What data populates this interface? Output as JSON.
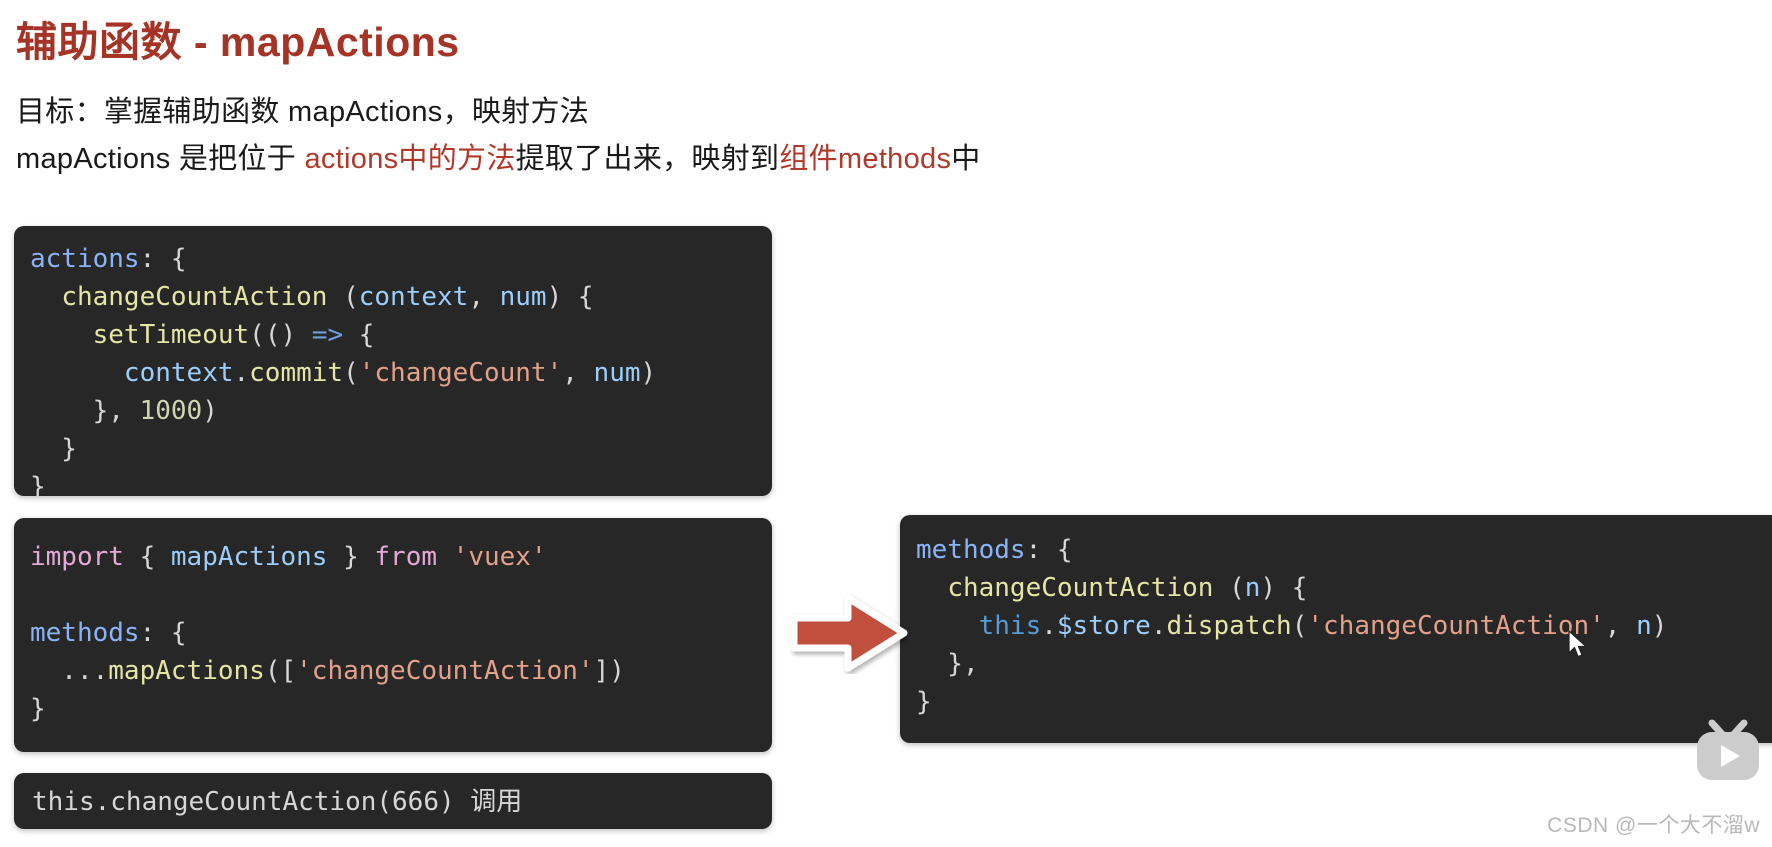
{
  "page": {
    "title": "辅助函数 - mapActions",
    "title_color": "#A53326",
    "background": "#ffffff"
  },
  "prose": {
    "goal": {
      "prefix": "目标：掌握辅助函数 mapActions，映射方法"
    },
    "description": {
      "seg1": "mapActions 是把位于 ",
      "seg2_red": "actions中的方法",
      "seg3": "提取了出来，映射到",
      "seg4_red": "组件methods",
      "seg5": "中"
    }
  },
  "code_blocks": {
    "actions": {
      "name": "actions-store-code",
      "lines": [
        {
          "tokens": [
            {
              "t": "actions",
              "c": "tok-key"
            },
            {
              "t": ": {",
              "c": "tok-plain"
            }
          ]
        },
        {
          "tokens": [
            {
              "t": "  ",
              "c": "tok-plain"
            },
            {
              "t": "changeCountAction",
              "c": "tok-fn"
            },
            {
              "t": " (",
              "c": "tok-plain"
            },
            {
              "t": "context",
              "c": "tok-param"
            },
            {
              "t": ", ",
              "c": "tok-plain"
            },
            {
              "t": "num",
              "c": "tok-param"
            },
            {
              "t": ") {",
              "c": "tok-plain"
            }
          ]
        },
        {
          "tokens": [
            {
              "t": "    ",
              "c": "tok-plain"
            },
            {
              "t": "setTimeout",
              "c": "tok-fn"
            },
            {
              "t": "(() ",
              "c": "tok-plain"
            },
            {
              "t": "=>",
              "c": "tok-arrow"
            },
            {
              "t": " {",
              "c": "tok-plain"
            }
          ]
        },
        {
          "tokens": [
            {
              "t": "      ",
              "c": "tok-plain"
            },
            {
              "t": "context",
              "c": "tok-param"
            },
            {
              "t": ".",
              "c": "tok-plain"
            },
            {
              "t": "commit",
              "c": "tok-fn"
            },
            {
              "t": "(",
              "c": "tok-plain"
            },
            {
              "t": "'changeCount'",
              "c": "tok-str"
            },
            {
              "t": ", ",
              "c": "tok-plain"
            },
            {
              "t": "num",
              "c": "tok-param"
            },
            {
              "t": ")",
              "c": "tok-plain"
            }
          ]
        },
        {
          "tokens": [
            {
              "t": "    }, ",
              "c": "tok-plain"
            },
            {
              "t": "1000",
              "c": "tok-num"
            },
            {
              "t": ")",
              "c": "tok-plain"
            }
          ]
        },
        {
          "tokens": [
            {
              "t": "  }",
              "c": "tok-plain"
            }
          ]
        },
        {
          "tokens": [
            {
              "t": "}",
              "c": "tok-plain"
            }
          ]
        }
      ]
    },
    "import": {
      "name": "component-mapactions-code",
      "lines": [
        {
          "tokens": [
            {
              "t": "import",
              "c": "tok-kw"
            },
            {
              "t": " { ",
              "c": "tok-plain"
            },
            {
              "t": "mapActions",
              "c": "tok-ident"
            },
            {
              "t": " } ",
              "c": "tok-plain"
            },
            {
              "t": "from",
              "c": "tok-kw"
            },
            {
              "t": " ",
              "c": "tok-plain"
            },
            {
              "t": "'vuex'",
              "c": "tok-str"
            }
          ]
        },
        {
          "tokens": [
            {
              "t": "",
              "c": "tok-plain"
            }
          ]
        },
        {
          "tokens": [
            {
              "t": "methods",
              "c": "tok-key"
            },
            {
              "t": ": {",
              "c": "tok-plain"
            }
          ]
        },
        {
          "tokens": [
            {
              "t": "  ...",
              "c": "tok-plain"
            },
            {
              "t": "mapActions",
              "c": "tok-fn"
            },
            {
              "t": "([",
              "c": "tok-plain"
            },
            {
              "t": "'changeCountAction'",
              "c": "tok-str"
            },
            {
              "t": "])",
              "c": "tok-plain"
            }
          ]
        },
        {
          "tokens": [
            {
              "t": "}",
              "c": "tok-plain"
            }
          ]
        }
      ]
    },
    "methods": {
      "name": "expanded-methods-code",
      "lines": [
        {
          "tokens": [
            {
              "t": "methods",
              "c": "tok-key"
            },
            {
              "t": ": {",
              "c": "tok-plain"
            }
          ]
        },
        {
          "tokens": [
            {
              "t": "  ",
              "c": "tok-plain"
            },
            {
              "t": "changeCountAction",
              "c": "tok-fn"
            },
            {
              "t": " (",
              "c": "tok-plain"
            },
            {
              "t": "n",
              "c": "tok-param"
            },
            {
              "t": ") {",
              "c": "tok-plain"
            }
          ]
        },
        {
          "tokens": [
            {
              "t": "    ",
              "c": "tok-plain"
            },
            {
              "t": "this",
              "c": "tok-this"
            },
            {
              "t": ".",
              "c": "tok-plain"
            },
            {
              "t": "$store",
              "c": "tok-param"
            },
            {
              "t": ".",
              "c": "tok-plain"
            },
            {
              "t": "dispatch",
              "c": "tok-fn"
            },
            {
              "t": "(",
              "c": "tok-plain"
            },
            {
              "t": "'changeCountAction'",
              "c": "tok-str"
            },
            {
              "t": ", ",
              "c": "tok-plain"
            },
            {
              "t": "n",
              "c": "tok-param"
            },
            {
              "t": ")",
              "c": "tok-plain"
            }
          ]
        },
        {
          "tokens": [
            {
              "t": "  },",
              "c": "tok-plain"
            }
          ]
        },
        {
          "tokens": [
            {
              "t": "}",
              "c": "tok-plain"
            }
          ]
        }
      ]
    },
    "call": {
      "name": "invocation-code",
      "lines": [
        {
          "tokens": [
            {
              "t": "this.changeCountAction(666) 调用",
              "c": "tok-plain"
            }
          ]
        }
      ]
    }
  },
  "arrow": {
    "name": "flow-arrow-right",
    "color": "#C04F3C",
    "outline": "#ffffff"
  },
  "logo": {
    "name": "bilibili-logo",
    "color": "#cccccc"
  },
  "watermark": {
    "text": "CSDN @一个大不溜w",
    "color": "#b9b9b9"
  }
}
